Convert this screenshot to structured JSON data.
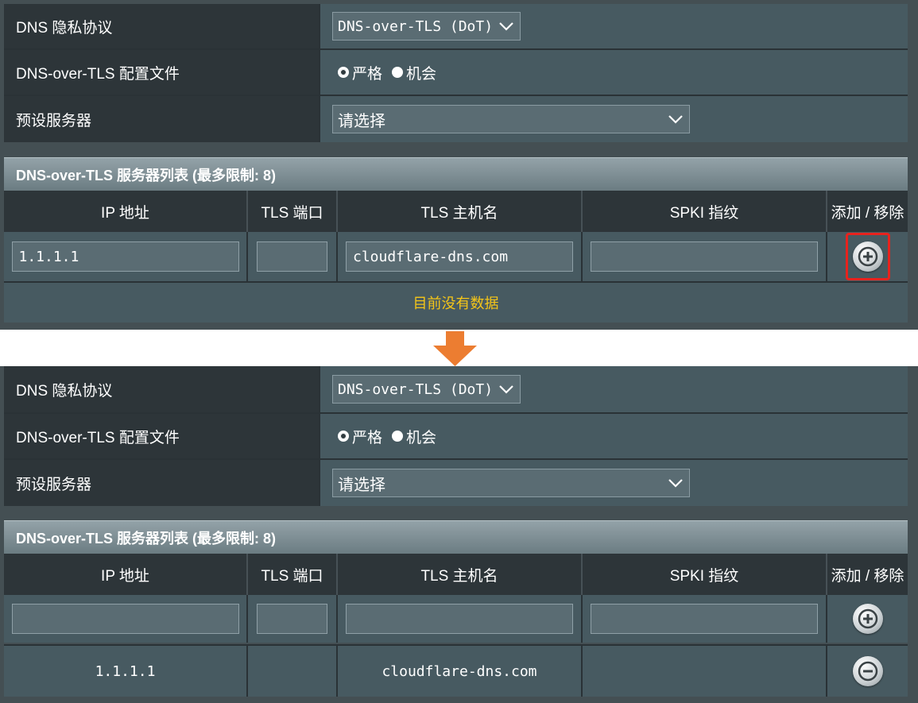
{
  "settings": {
    "dns_privacy_label": "DNS 隐私协议",
    "dns_privacy_value": "DNS-over-TLS (DoT)",
    "profile_label": "DNS-over-TLS 配置文件",
    "profile_options": [
      "严格",
      "机会"
    ],
    "preset_label": "预设服务器",
    "preset_value": "请选择"
  },
  "server_list": {
    "title": "DNS-over-TLS 服务器列表 (最多限制: 8)",
    "columns": [
      "IP 地址",
      "TLS 端口",
      "TLS 主机名",
      "SPKI 指纹",
      "添加 / 移除"
    ],
    "no_data": "目前没有数据"
  },
  "before": {
    "inputs": {
      "ip": "1.1.1.1",
      "port": "",
      "hostname": "cloudflare-dns.com",
      "spki": ""
    }
  },
  "after": {
    "inputs": {
      "ip": "",
      "port": "",
      "hostname": "",
      "spki": ""
    },
    "rows": [
      {
        "ip": "1.1.1.1",
        "port": "",
        "hostname": "cloudflare-dns.com",
        "spki": ""
      }
    ]
  },
  "colors": {
    "highlight": "#e8221d",
    "arrow": "#ec7d31",
    "no_data_text": "#f5c518"
  },
  "icons": {
    "add": "add-circle-icon",
    "remove": "remove-circle-icon",
    "arrow": "down-arrow-icon"
  }
}
